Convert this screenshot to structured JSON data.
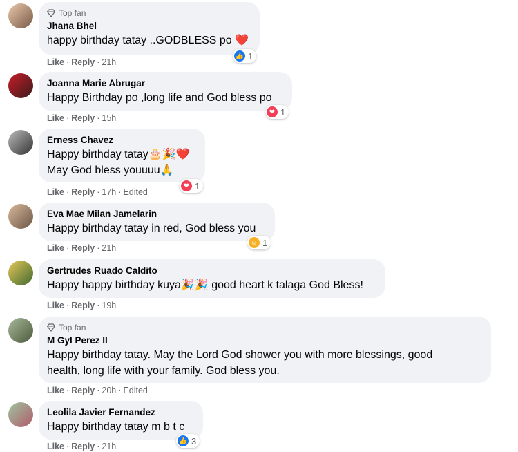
{
  "comments": [
    {
      "name": "Jhana Bhel",
      "top_fan": "Top fan",
      "lines": [
        "happy birthday tatay ..GODBLESS po ❤️"
      ],
      "reaction": {
        "icon": "like-icon",
        "count": "1"
      },
      "like": "Like",
      "reply": "Reply",
      "time": "21h",
      "edited": ""
    },
    {
      "name": "Joanna Marie Abrugar",
      "top_fan": "",
      "lines": [
        "Happy Birthday po ,long life and God bless po"
      ],
      "reaction": {
        "icon": "love-icon",
        "count": "1"
      },
      "like": "Like",
      "reply": "Reply",
      "time": "15h",
      "edited": ""
    },
    {
      "name": "Erness Chavez",
      "top_fan": "",
      "lines": [
        "Happy birthday tatay🎂🎉❤️",
        "May God bless youuuu🙏"
      ],
      "reaction": {
        "icon": "love-icon",
        "count": "1"
      },
      "like": "Like",
      "reply": "Reply",
      "time": "17h",
      "edited": "Edited"
    },
    {
      "name": "Eva Mae Milan Jamelarin",
      "top_fan": "",
      "lines": [
        "Happy birthday tatay in red, God bless you"
      ],
      "reaction": {
        "icon": "care-icon",
        "count": "1"
      },
      "like": "Like",
      "reply": "Reply",
      "time": "21h",
      "edited": ""
    },
    {
      "name": "Gertrudes Ruado Caldito",
      "top_fan": "",
      "lines": [
        "Happy happy birthday kuya🎉🎉 good heart k talaga God Bless!"
      ],
      "reaction": null,
      "like": "Like",
      "reply": "Reply",
      "time": "19h",
      "edited": ""
    },
    {
      "name": "M Gyl Perez II",
      "top_fan": "Top fan",
      "lines": [
        "Happy birthday tatay. May the Lord God shower you with more blessings, good",
        "health, long life with your family. God bless you."
      ],
      "reaction": null,
      "like": "Like",
      "reply": "Reply",
      "time": "20h",
      "edited": "Edited"
    },
    {
      "name": "Leolila Javier Fernandez",
      "top_fan": "",
      "lines": [
        "Happy birthday tatay m b t c"
      ],
      "reaction": {
        "icon": "like-icon",
        "count": "3"
      },
      "like": "Like",
      "reply": "Reply",
      "time": "21h",
      "edited": ""
    }
  ],
  "colors": {
    "like": "#1877f2",
    "love": "#f33e58",
    "care": "#f7b125",
    "bubble": "#f0f2f5",
    "meta": "#65676b"
  }
}
